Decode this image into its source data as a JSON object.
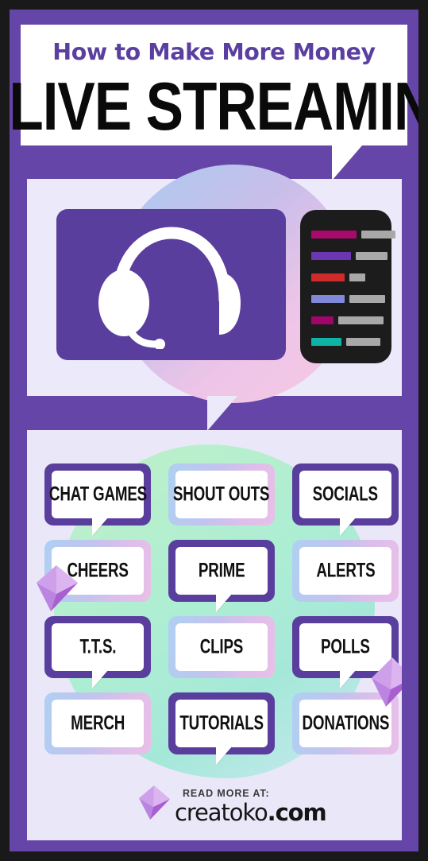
{
  "header": {
    "kicker": "How to Make More Money",
    "headline": "LIVE STREAMING"
  },
  "illustration": {
    "screen_icon": "headset-icon",
    "chat_rows": [
      {
        "name_color": "#A8096B",
        "name_width": 57,
        "msg_color": "#A8A8A8",
        "msg_width": 43
      },
      {
        "name_color": "#6A37B0",
        "name_width": 50,
        "msg_color": "#A8A8A8",
        "msg_width": 40
      },
      {
        "name_color": "#CF2B2B",
        "name_width": 42,
        "msg_color": "#A8A8A8",
        "msg_width": 20
      },
      {
        "name_color": "#8089D8",
        "name_width": 42,
        "msg_color": "#A8A8A8",
        "msg_width": 45
      },
      {
        "name_color": "#A0056A",
        "name_width": 28,
        "msg_color": "#A8A8A8",
        "msg_width": 57
      },
      {
        "name_color": "#0FB3A6",
        "name_width": 38,
        "msg_color": "#A8A8A8",
        "msg_width": 43
      }
    ]
  },
  "tiles": [
    {
      "label": "CHAT GAMES",
      "style": "solid",
      "tail": true
    },
    {
      "label": "SHOUT OUTS",
      "style": "grad",
      "tail": false
    },
    {
      "label": "SOCIALS",
      "style": "solid",
      "tail": true
    },
    {
      "label": "CHEERS",
      "style": "grad",
      "tail": false
    },
    {
      "label": "PRIME",
      "style": "solid",
      "tail": true
    },
    {
      "label": "ALERTS",
      "style": "grad",
      "tail": false
    },
    {
      "label": "T.T.S.",
      "style": "solid",
      "tail": true
    },
    {
      "label": "CLIPS",
      "style": "grad",
      "tail": false
    },
    {
      "label": "POLLS",
      "style": "solid",
      "tail": true
    },
    {
      "label": "MERCH",
      "style": "grad",
      "tail": false
    },
    {
      "label": "TUTORIALS",
      "style": "solid",
      "tail": true
    },
    {
      "label": "DONATIONS",
      "style": "grad",
      "tail": false
    }
  ],
  "footer": {
    "read_more": "READ MORE AT:",
    "brand_name": "creatoko",
    "brand_tld": ".com",
    "logo_icon": "gem-icon"
  },
  "colors": {
    "frame": "#191919",
    "background_purple": "#6546A8",
    "panel_white": "#FFFFFF",
    "panel_lavender": "#EAE8F8",
    "accent_purple": "#5A3E9E",
    "kicker_purple": "#5B3FA0",
    "chat_panel": "#1C1C1C",
    "gem_light": "#D8AFEC",
    "gem_mid": "#C489E4",
    "gem_dark": "#A85FD2"
  }
}
